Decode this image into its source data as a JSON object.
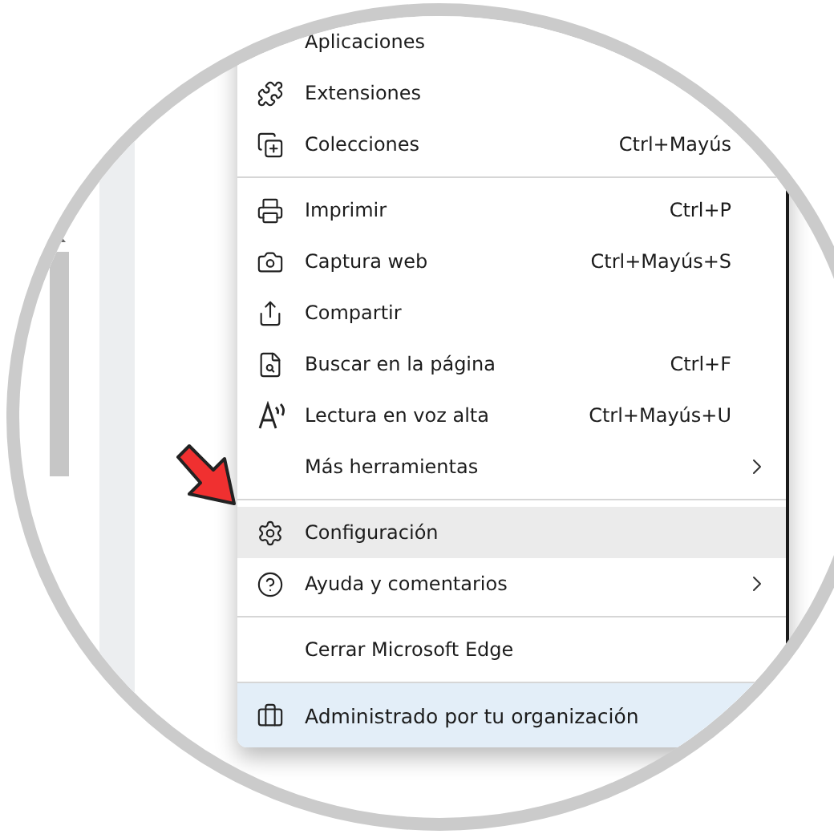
{
  "menu": {
    "sections": [
      {
        "items": [
          {
            "label": "Aplicaciones",
            "submenu": false,
            "selected": false
          },
          {
            "label": "Extensiones",
            "submenu": false,
            "selected": false
          },
          {
            "label": "Colecciones",
            "shortcut": "Ctrl+Mayús",
            "submenu": false,
            "selected": false
          }
        ]
      },
      {
        "items": [
          {
            "label": "Imprimir",
            "shortcut": "Ctrl+P",
            "submenu": false,
            "selected": false
          },
          {
            "label": "Captura web",
            "shortcut": "Ctrl+Mayús+S",
            "submenu": false,
            "selected": false
          },
          {
            "label": "Compartir",
            "submenu": false,
            "selected": false
          },
          {
            "label": "Buscar en la página",
            "shortcut": "Ctrl+F",
            "submenu": false,
            "selected": false
          },
          {
            "label": "Lectura en voz alta",
            "shortcut": "Ctrl+Mayús+U",
            "submenu": false,
            "selected": false
          },
          {
            "label": "Más herramientas",
            "submenu": true,
            "selected": false
          }
        ]
      },
      {
        "items": [
          {
            "label": "Configuración",
            "submenu": false,
            "selected": true
          },
          {
            "label": "Ayuda y comentarios",
            "submenu": true,
            "selected": false
          }
        ]
      },
      {
        "items": [
          {
            "label": "Cerrar Microsoft Edge",
            "submenu": false,
            "selected": false
          }
        ]
      }
    ],
    "managed": {
      "label": "Administrado por tu organización"
    }
  }
}
